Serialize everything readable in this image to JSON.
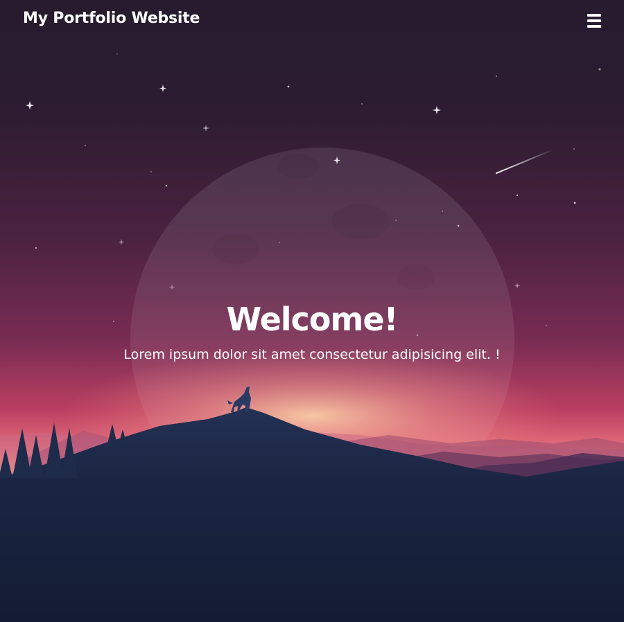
{
  "header": {
    "title": "My Portfolio Website",
    "menu_icon": "hamburger-menu-icon"
  },
  "hero": {
    "title": "Welcome!",
    "subtitle": "Lorem ipsum dolor sit amet consectetur adipisicing elit. !"
  },
  "colors": {
    "sky_top": "#271b2e",
    "sky_mid": "#7a2c52",
    "horizon_glow": "#f4b08a",
    "foreground_hill": "#243154",
    "ground": "#141c33",
    "text": "#ffffff"
  }
}
